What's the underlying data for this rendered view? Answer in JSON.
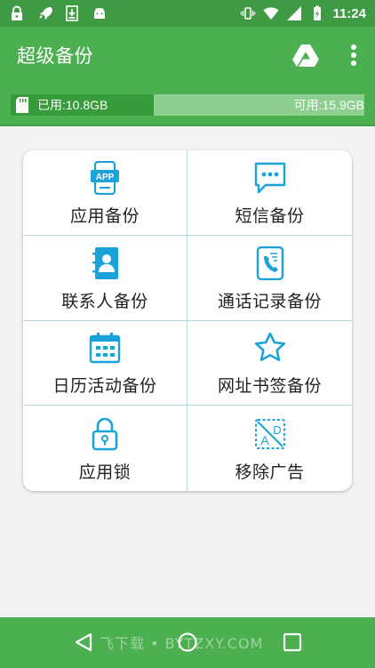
{
  "status_bar": {
    "time": "11:24",
    "icons_left": [
      "lock-icon",
      "rocket-icon",
      "download-icon",
      "android-icon"
    ],
    "icons_right": [
      "vibrate-icon",
      "wifi-icon",
      "signal-icon",
      "battery-charging-icon"
    ]
  },
  "app_bar": {
    "title": "超级备份",
    "action_icons": [
      "google-drive-icon",
      "more-vert-icon"
    ]
  },
  "storage": {
    "used_label": "已用:10.8GB",
    "free_label": "可用:15.9GB",
    "used_fraction": 0.405,
    "icon": "sd-card-icon"
  },
  "menu": {
    "items": [
      {
        "label": "应用备份",
        "icon": "app-icon"
      },
      {
        "label": "短信备份",
        "icon": "sms-icon"
      },
      {
        "label": "联系人备份",
        "icon": "contacts-icon"
      },
      {
        "label": "通话记录备份",
        "icon": "call-log-icon"
      },
      {
        "label": "日历活动备份",
        "icon": "calendar-icon"
      },
      {
        "label": "网址书签备份",
        "icon": "bookmark-star-icon"
      },
      {
        "label": "应用锁",
        "icon": "lock-icon"
      },
      {
        "label": "移除广告",
        "icon": "remove-ads-icon"
      }
    ]
  },
  "nav_bar": {
    "watermark": "飞下载 • BYTZXY.COM",
    "buttons": [
      "back-icon",
      "home-icon",
      "recents-icon"
    ]
  },
  "colors": {
    "primary": "#4caf50",
    "primary_dark": "#3f9b43",
    "storage_used": "#379a3b",
    "storage_free": "#8ccf8f",
    "icon_accent": "#1aa3d9"
  }
}
